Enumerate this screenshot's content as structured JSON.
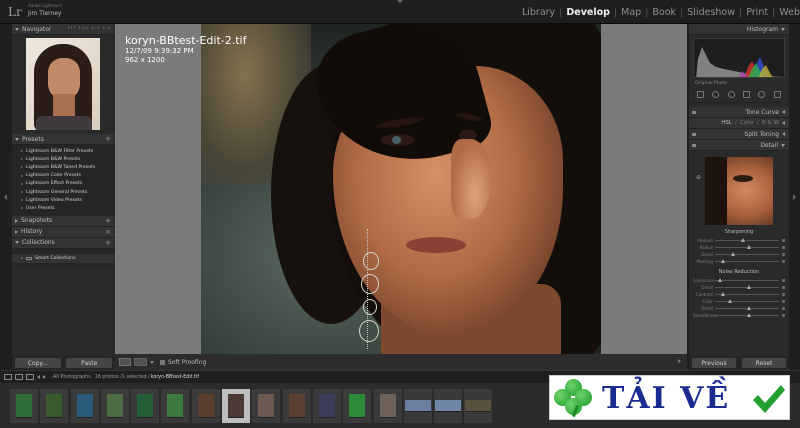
{
  "identity": {
    "logo": "Lr",
    "product": "Adobe Lightroom",
    "user": "Jim Tierney"
  },
  "modules": [
    "Library",
    "Develop",
    "Map",
    "Book",
    "Slideshow",
    "Print",
    "Web"
  ],
  "active_module": "Develop",
  "left_panel": {
    "navigator": {
      "title": "Navigator",
      "options": "FIT   FILL   1:1   3:1"
    },
    "presets": {
      "title": "Presets",
      "items": [
        "Lightroom B&W Filter Presets",
        "Lightroom B&W Presets",
        "Lightroom B&W Toned Presets",
        "Lightroom Color Presets",
        "Lightroom Effect Presets",
        "Lightroom General Presets",
        "Lightroom Video Presets",
        "User Presets"
      ]
    },
    "snapshots_title": "Snapshots",
    "history_title": "History",
    "collections": {
      "title": "Collections",
      "items": [
        "Smart Collections"
      ]
    },
    "copy_label": "Copy...",
    "paste_label": "Paste"
  },
  "photo": {
    "filename": "koryn-BBtest-Edit-2.tif",
    "datetime": "12/7/09 9:39:32 PM",
    "dimensions": "962 x 1200"
  },
  "toolbar": {
    "soft_proofing": "Soft Proofing"
  },
  "right_panel": {
    "histogram_title": "Histogram",
    "original_photo": "Original Photo",
    "tone_curve": "Tone Curve",
    "hsl": "HSL",
    "color": "Color",
    "bw": "B & W",
    "split_toning": "Split Toning",
    "detail": "Detail",
    "sharpening": {
      "title": "Sharpening",
      "sliders": [
        "Amount",
        "Radius",
        "Detail",
        "Masking"
      ],
      "values": [
        0.4,
        0.5,
        0.25,
        0.1
      ]
    },
    "noise_reduction": {
      "title": "Noise Reduction",
      "sliders": [
        "Luminance",
        "Detail",
        "Contrast",
        "Color",
        "Detail",
        "Smoothness"
      ],
      "values": [
        0.05,
        0.5,
        0.1,
        0.2,
        0.5,
        0.5
      ]
    },
    "previous_label": "Previous",
    "reset_label": "Reset"
  },
  "filmstrip_bar": {
    "source": "All Photographs",
    "count": "16 photos /1 selected /",
    "selected_file": "koryn-BBtest-Edit.tif"
  },
  "filmstrip": [
    {
      "color": "#2f6e38",
      "wide": false
    },
    {
      "color": "#3a5a2c",
      "wide": false
    },
    {
      "color": "#2a5c7a",
      "wide": false
    },
    {
      "color": "#4d6b45",
      "wide": false
    },
    {
      "color": "#245f3a",
      "wide": false
    },
    {
      "color": "#3d7a40",
      "wide": false
    },
    {
      "color": "#5a3e30",
      "wide": false
    },
    {
      "color": "#4a3a33",
      "wide": false,
      "selected": true
    },
    {
      "color": "#6a5a50",
      "wide": false
    },
    {
      "color": "#5b4035",
      "wide": false
    },
    {
      "color": "#3b3c57",
      "wide": false
    },
    {
      "color": "#2c8a3a",
      "wide": false
    },
    {
      "color": "#6e6258",
      "wide": false
    },
    {
      "color": "#6d7fa0",
      "wide": true
    },
    {
      "color": "#6f86a4",
      "wide": true
    },
    {
      "color": "#5a5040",
      "wide": true
    }
  ],
  "banner": {
    "text": "TẢI VỀ",
    "text_color": "#1a2c8f",
    "check_color": "#22a02f",
    "icon": "four-leaf-clover-icon"
  }
}
